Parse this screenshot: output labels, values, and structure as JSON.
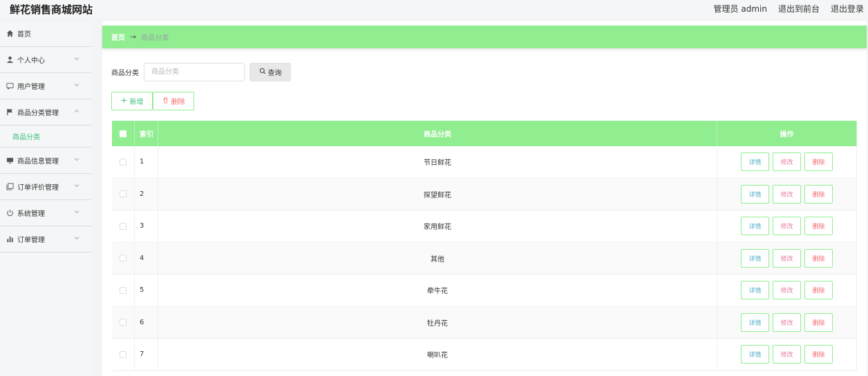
{
  "header": {
    "site_title": "鲜花销售商城网站",
    "admin_label": "管理员 admin",
    "to_front": "退出到前台",
    "logout": "退出登录"
  },
  "sidebar": {
    "items": [
      {
        "label": "首页",
        "icon": "home-icon"
      },
      {
        "label": "个人中心",
        "icon": "user-icon"
      },
      {
        "label": "用户管理",
        "icon": "chat-icon"
      },
      {
        "label": "商品分类管理",
        "icon": "flag-icon"
      },
      {
        "label": "商品信息管理",
        "icon": "monitor-icon"
      },
      {
        "label": "订单评价管理",
        "icon": "copy-icon"
      },
      {
        "label": "系统管理",
        "icon": "power-icon"
      },
      {
        "label": "订单管理",
        "icon": "bar-chart-icon"
      }
    ],
    "sub_item": "商品分类"
  },
  "breadcrumb": {
    "home": "首页",
    "separator": "→",
    "current": "商品分类"
  },
  "search": {
    "label": "商品分类",
    "placeholder": "商品分类",
    "button": "查询"
  },
  "actions": {
    "add": "新增",
    "delete": "删除"
  },
  "table": {
    "headers": {
      "index": "索引",
      "name": "商品分类",
      "ops": "操作"
    },
    "op_labels": {
      "detail": "详情",
      "edit": "修改",
      "delete": "删除"
    },
    "rows": [
      {
        "index": "1",
        "name": "节日鲜花"
      },
      {
        "index": "2",
        "name": "探望鲜花"
      },
      {
        "index": "3",
        "name": "家用鲜花"
      },
      {
        "index": "4",
        "name": "其他"
      },
      {
        "index": "5",
        "name": "牵牛花"
      },
      {
        "index": "6",
        "name": "牡丹花"
      },
      {
        "index": "7",
        "name": "喇叭花"
      }
    ]
  },
  "colors": {
    "accent": "#90ee90",
    "active_menu": "#3cc07f",
    "danger": "#f56c6c"
  }
}
